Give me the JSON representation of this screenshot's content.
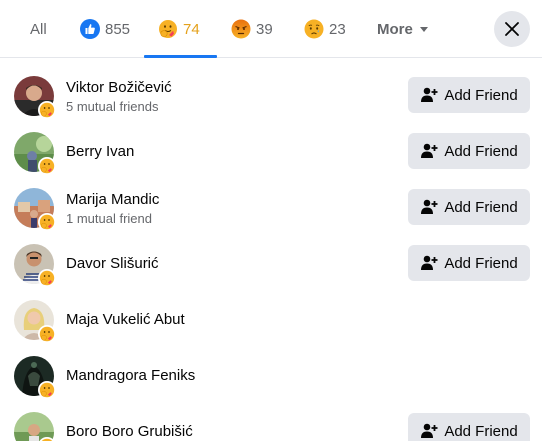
{
  "tabs": {
    "all": {
      "label": "All"
    },
    "like": {
      "count": "855"
    },
    "care": {
      "count": "74"
    },
    "angry": {
      "count": "39"
    },
    "sad": {
      "count": "23"
    },
    "more": {
      "label": "More"
    }
  },
  "colors": {
    "accent": "#1877f2",
    "active_tab": "#e4a11b",
    "button_bg": "#e4e6eb",
    "secondary_text": "#65676b"
  },
  "people": [
    {
      "name": "Viktor Božičević",
      "mutual": "5 mutual friends",
      "action": "Add Friend"
    },
    {
      "name": "Berry Ivan",
      "mutual": "",
      "action": "Add Friend"
    },
    {
      "name": "Marija Mandic",
      "mutual": "1 mutual friend",
      "action": "Add Friend"
    },
    {
      "name": "Davor Slišurić",
      "mutual": "",
      "action": "Add Friend"
    },
    {
      "name": "Maja Vukelić Abut",
      "mutual": "",
      "action": ""
    },
    {
      "name": "Mandragora Feniks",
      "mutual": "",
      "action": ""
    },
    {
      "name": "Boro Boro Grubišić",
      "mutual": "",
      "action": "Add Friend"
    }
  ],
  "icons": {
    "close": "close-icon",
    "add_friend": "add-person-icon",
    "reaction": "care-reaction-icon"
  }
}
